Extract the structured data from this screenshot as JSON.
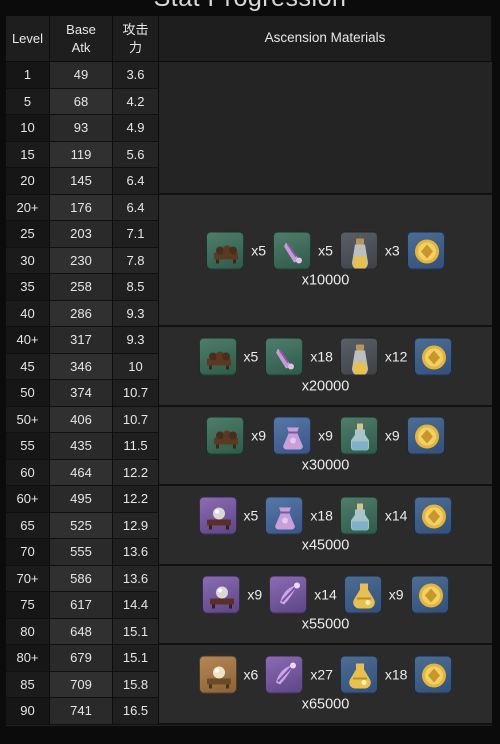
{
  "title": "Stat Progression",
  "headers": {
    "level": "Level",
    "atk": "Base\nAtk",
    "sub": "攻击\n力",
    "materials": "Ascension Materials"
  },
  "rows": [
    {
      "level": "1",
      "atk": "49",
      "sub": "3.6"
    },
    {
      "level": "5",
      "atk": "68",
      "sub": "4.2"
    },
    {
      "level": "10",
      "atk": "93",
      "sub": "4.9"
    },
    {
      "level": "15",
      "atk": "119",
      "sub": "5.6"
    },
    {
      "level": "20",
      "atk": "145",
      "sub": "6.4"
    },
    {
      "level": "20+",
      "atk": "176",
      "sub": "6.4"
    },
    {
      "level": "25",
      "atk": "203",
      "sub": "7.1"
    },
    {
      "level": "30",
      "atk": "230",
      "sub": "7.8"
    },
    {
      "level": "35",
      "atk": "258",
      "sub": "8.5"
    },
    {
      "level": "40",
      "atk": "286",
      "sub": "9.3"
    },
    {
      "level": "40+",
      "atk": "317",
      "sub": "9.3"
    },
    {
      "level": "45",
      "atk": "346",
      "sub": "10"
    },
    {
      "level": "50",
      "atk": "374",
      "sub": "10.7"
    },
    {
      "level": "50+",
      "atk": "406",
      "sub": "10.7"
    },
    {
      "level": "55",
      "atk": "435",
      "sub": "11.5"
    },
    {
      "level": "60",
      "atk": "464",
      "sub": "12.2"
    },
    {
      "level": "60+",
      "atk": "495",
      "sub": "12.2"
    },
    {
      "level": "65",
      "atk": "525",
      "sub": "12.9"
    },
    {
      "level": "70",
      "atk": "555",
      "sub": "13.6"
    },
    {
      "level": "70+",
      "atk": "586",
      "sub": "13.6"
    },
    {
      "level": "75",
      "atk": "617",
      "sub": "14.4"
    },
    {
      "level": "80",
      "atk": "648",
      "sub": "15.1"
    },
    {
      "level": "80+",
      "atk": "679",
      "sub": "15.1"
    },
    {
      "level": "85",
      "atk": "709",
      "sub": "15.8"
    },
    {
      "level": "90",
      "atk": "741",
      "sub": "16.5"
    }
  ],
  "ascensions": [
    {
      "items": [
        {
          "icon": "teapot-stand-icon",
          "qty": "x5"
        },
        {
          "icon": "dried-flower-icon",
          "qty": "x5"
        },
        {
          "icon": "cork-vial-icon",
          "qty": "x3"
        }
      ],
      "mora": "x10000"
    },
    {
      "items": [
        {
          "icon": "teapot-stand-icon",
          "qty": "x5"
        },
        {
          "icon": "dried-flower-icon",
          "qty": "x18"
        },
        {
          "icon": "cork-vial-icon",
          "qty": "x12"
        }
      ],
      "mora": "x20000"
    },
    {
      "items": [
        {
          "icon": "teapot-stand-icon",
          "qty": "x9"
        },
        {
          "icon": "scented-pouch-icon",
          "qty": "x9"
        },
        {
          "icon": "fragrant-bottle-icon",
          "qty": "x9"
        }
      ],
      "mora": "x30000"
    },
    {
      "items": [
        {
          "icon": "pearl-stand-icon",
          "qty": "x5"
        },
        {
          "icon": "scented-pouch-icon",
          "qty": "x18"
        },
        {
          "icon": "fragrant-bottle-icon",
          "qty": "x14"
        }
      ],
      "mora": "x45000"
    },
    {
      "items": [
        {
          "icon": "pearl-stand-icon",
          "qty": "x9"
        },
        {
          "icon": "ornate-flower-icon",
          "qty": "x14"
        },
        {
          "icon": "golden-flask-icon",
          "qty": "x9"
        }
      ],
      "mora": "x55000"
    },
    {
      "items": [
        {
          "icon": "golden-orb-stand-icon",
          "qty": "x6"
        },
        {
          "icon": "ornate-flower-icon",
          "qty": "x27"
        },
        {
          "icon": "golden-flask-icon",
          "qty": "x18"
        }
      ],
      "mora": "x65000"
    }
  ],
  "mora_icon": "mora-coin-icon"
}
